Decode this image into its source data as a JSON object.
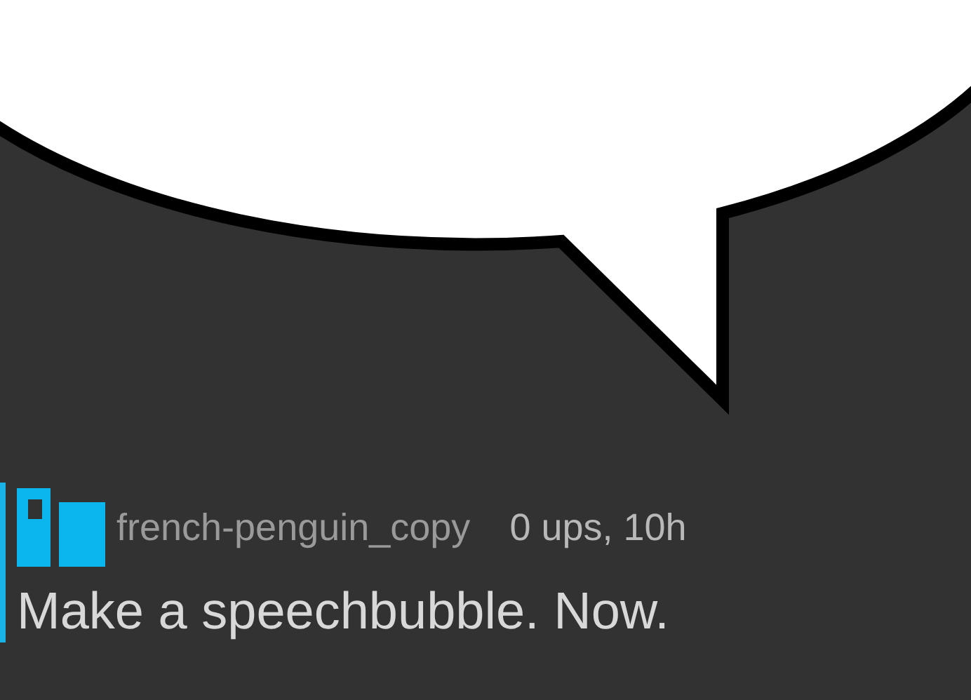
{
  "comment": {
    "username": "french-penguin_copy",
    "meta": "0 ups, 10h",
    "text": "Make a speechbubble. Now."
  }
}
